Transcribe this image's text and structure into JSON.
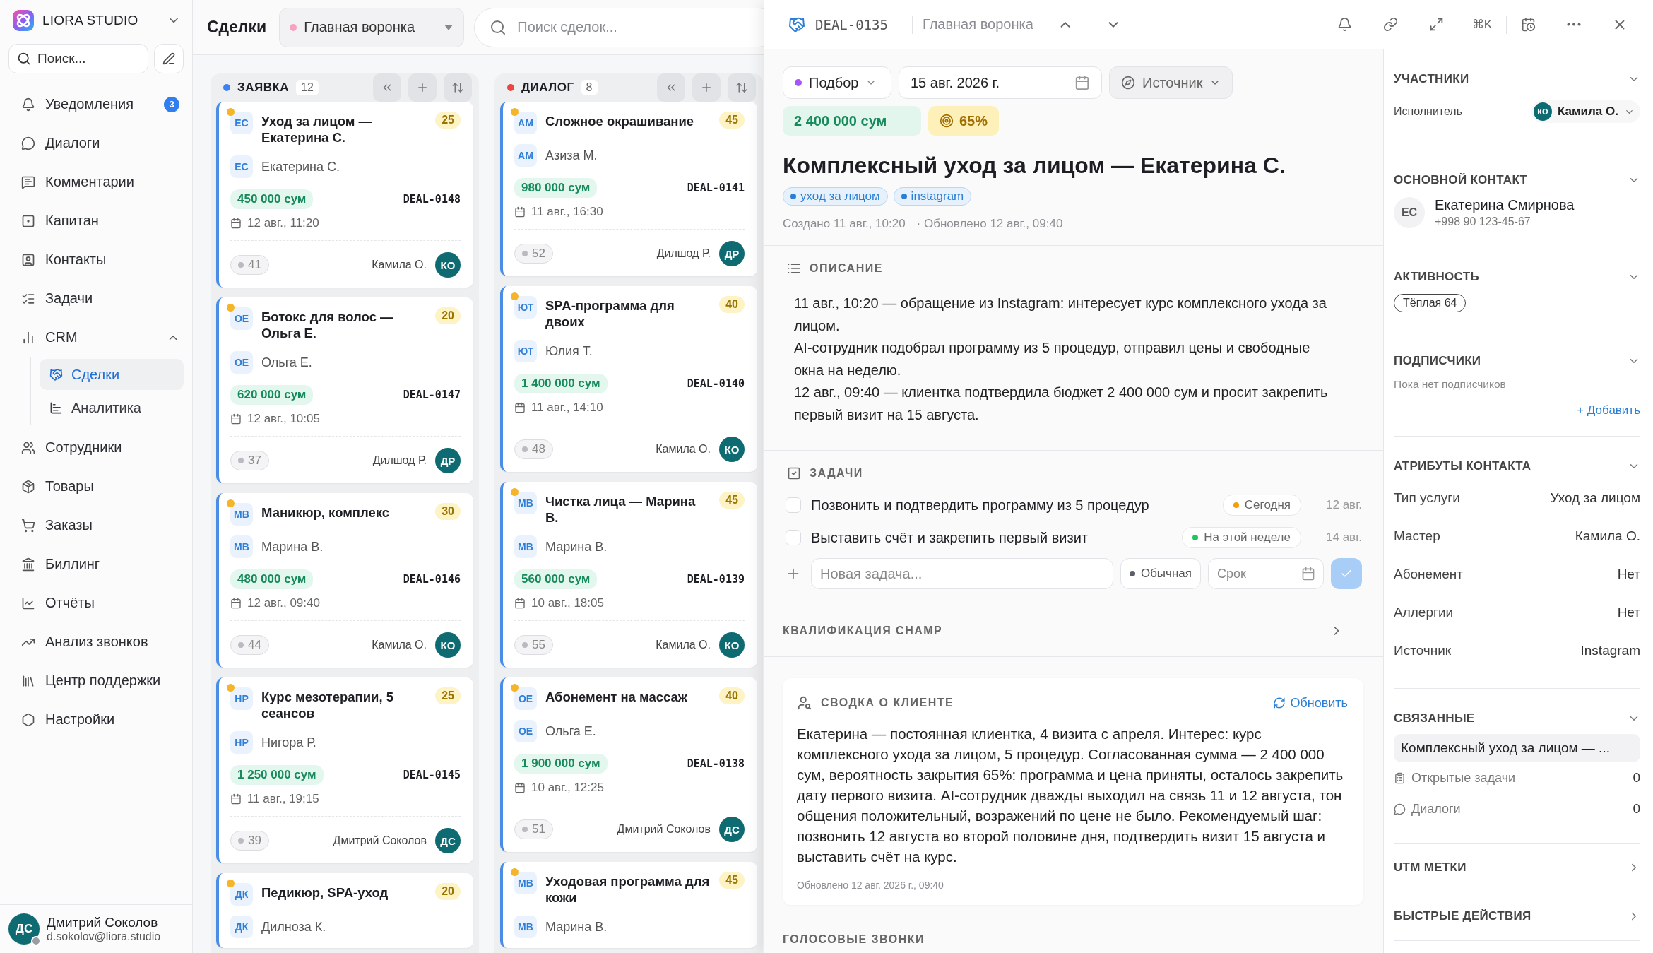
{
  "sidebar": {
    "brand": "LIORA STUDIO",
    "search": {
      "placeholder": "Поиск..."
    },
    "items": [
      {
        "label": "Уведомления",
        "badge": "3",
        "selected": false
      },
      {
        "label": "Диалоги",
        "selected": false
      },
      {
        "label": "Комментарии",
        "selected": false
      },
      {
        "label": "Капитан",
        "selected": false
      },
      {
        "label": "Контакты",
        "selected": false
      },
      {
        "label": "Задачи",
        "selected": false
      },
      {
        "label": "CRM",
        "selected": false,
        "expanded": true,
        "children": [
          {
            "label": "Сделки",
            "selected": true
          },
          {
            "label": "Аналитика",
            "selected": false
          }
        ]
      },
      {
        "label": "Сотрудники",
        "selected": false
      },
      {
        "label": "Товары",
        "selected": false
      },
      {
        "label": "Заказы",
        "selected": false
      },
      {
        "label": "Биллинг",
        "selected": false
      },
      {
        "label": "Отчёты",
        "selected": false
      },
      {
        "label": "Анализ звонков",
        "selected": false
      },
      {
        "label": "Центр поддержки",
        "selected": false
      },
      {
        "label": "Настройки",
        "selected": false
      }
    ],
    "user": {
      "initials": "ДС",
      "name": "Дмитрий Соколов",
      "email": "d.sokolov@liora.studio"
    }
  },
  "board": {
    "title": "Сделки",
    "pipeline": "Главная воронка",
    "search": {
      "placeholder": "Поиск сделок..."
    },
    "columns": [
      {
        "name": "ЗАЯВКА",
        "count": "12",
        "color": "#3b82f6",
        "cards": [
          {
            "initials": "ЕС",
            "title": "Уход за лицом — Екатерина С.",
            "score": "25",
            "contact": "Екатерина С.",
            "contact_initials": "ЕС",
            "amount": "450 000 сум",
            "deal_id": "DEAL-0148",
            "date": "12 авг., 11:20",
            "comments": "41",
            "owner": "Камила О.",
            "owner_initials": "КО"
          },
          {
            "initials": "ОЕ",
            "title": "Ботокс для волос — Ольга Е.",
            "score": "20",
            "contact": "Ольга Е.",
            "contact_initials": "ОЕ",
            "amount": "620 000 сум",
            "deal_id": "DEAL-0147",
            "date": "12 авг., 10:05",
            "comments": "37",
            "owner": "Дилшод Р.",
            "owner_initials": "ДР"
          },
          {
            "initials": "МВ",
            "title": "Маникюр, комплекс",
            "score": "30",
            "contact": "Марина В.",
            "contact_initials": "МВ",
            "amount": "480 000 сум",
            "deal_id": "DEAL-0146",
            "date": "12 авг., 09:40",
            "comments": "44",
            "owner": "Камила О.",
            "owner_initials": "КО"
          },
          {
            "initials": "НР",
            "title": "Курс мезотерапии, 5 сеансов",
            "score": "25",
            "contact": "Нигора Р.",
            "contact_initials": "НР",
            "amount": "1 250 000 сум",
            "deal_id": "DEAL-0145",
            "date": "11 авг., 19:15",
            "comments": "39",
            "owner": "Дмитрий Соколов",
            "owner_initials": "ДС"
          },
          {
            "initials": "ДК",
            "title": "Педикюр, SPA-уход",
            "score": "20",
            "contact": "Дилноза К.",
            "contact_initials": "ДК"
          }
        ]
      },
      {
        "name": "ДИАЛОГ",
        "count": "8",
        "color": "#ef4444",
        "cards": [
          {
            "initials": "АМ",
            "title": "Сложное окрашивание",
            "score": "45",
            "contact": "Азиза М.",
            "contact_initials": "АМ",
            "amount": "980 000 сум",
            "deal_id": "DEAL-0141",
            "date": "11 авг., 16:30",
            "comments": "52",
            "owner": "Дилшод Р.",
            "owner_initials": "ДР"
          },
          {
            "initials": "ЮТ",
            "title": "SPA-программа для двоих",
            "score": "40",
            "contact": "Юлия Т.",
            "contact_initials": "ЮТ",
            "amount": "1 400 000 сум",
            "deal_id": "DEAL-0140",
            "date": "11 авг., 14:10",
            "comments": "48",
            "owner": "Камила О.",
            "owner_initials": "КО"
          },
          {
            "initials": "МВ",
            "title": "Чистка лица — Марина В.",
            "score": "45",
            "contact": "Марина В.",
            "contact_initials": "МВ",
            "amount": "560 000 сум",
            "deal_id": "DEAL-0139",
            "date": "10 авг., 18:05",
            "comments": "55",
            "owner": "Камила О.",
            "owner_initials": "КО"
          },
          {
            "initials": "ОЕ",
            "title": "Абонемент на массаж",
            "score": "40",
            "contact": "Ольга Е.",
            "contact_initials": "ОЕ",
            "amount": "1 900 000 сум",
            "deal_id": "DEAL-0138",
            "date": "10 авг., 12:25",
            "comments": "51",
            "owner": "Дмитрий Соколов",
            "owner_initials": "ДС"
          },
          {
            "initials": "МВ",
            "title": "Уходовая программа для кожи",
            "score": "45",
            "contact": "Марина В.",
            "contact_initials": "МВ"
          }
        ]
      }
    ]
  },
  "detail": {
    "deal_id": "DEAL-0135",
    "pipeline": "Главная воронка",
    "shortcut": "⌘K",
    "stage": {
      "label": "Подбор",
      "color": "#a855f7"
    },
    "date": "15 авг. 2026 г.",
    "source": "Источник",
    "amount": "2 400 000 сум",
    "probability": "65%",
    "title": "Комплексный уход за лицом — Екатерина С.",
    "tags": [
      "уход за лицом",
      "instagram"
    ],
    "created": "Создано 11 авг., 10:20",
    "updated": "· Обновлено 12 авг., 09:40",
    "description": {
      "title": "ОПИСАНИЕ",
      "lines": [
        "11 авг., 10:20 — обращение из Instagram: интересует курс комплексного ухода за лицом.",
        "AI-сотрудник подобрал программу из 5 процедур, отправил цены и свободные окна на неделю.",
        "12 авг., 09:40 — клиентка подтвердила бюджет 2 400 000 сум и просит закрепить первый визит на 15 августа."
      ]
    },
    "tasks": {
      "title": "ЗАДАЧИ",
      "items": [
        {
          "text": "Позвонить и подтвердить программу из 5 процедур",
          "checked": false,
          "due": "Сегодня",
          "color": "#f59e0b",
          "date": "12 авг."
        },
        {
          "text": "Выставить счёт и закрепить первый визит",
          "checked": false,
          "due": "На этой неделе",
          "color": "#22c55e",
          "date": "14 авг."
        }
      ],
      "new_task": {
        "placeholder": "Новая задача...",
        "priority": "Обычная",
        "deadline_placeholder": "Срок"
      }
    },
    "qualification": {
      "title": "КВАЛИФИКАЦИЯ CHAMP",
      "expanded": false
    },
    "summary": {
      "title": "СВОДКА О КЛИЕНТЕ",
      "refresh": "Обновить",
      "text": "Екатерина — постоянная клиентка, 4 визита с апреля. Интерес: курс комплексного ухода за лицом, 5 процедур. Согласованная сумма — 2 400 000 сум, вероятность закрытия 65%: программа и цена приняты, осталось закрепить дату первого визита. AI-сотрудник дважды выходил на связь 11 и 12 августа, тон общения положительный, возражений по цене не было. Рекомендуемый шаг: позвонить 12 августа во второй половине дня, подтвердить визит 15 августа и выставить счёт на курс.",
      "updated": "Обновлено 12 авг. 2026 г., 09:40"
    },
    "voice_calls": {
      "title": "ГОЛОСОВЫЕ ЗВОНКИ"
    }
  },
  "panel": {
    "sections": [
      {
        "kind": "assignee",
        "title": "УЧАСТНИКИ",
        "expanded": true,
        "label": "Исполнитель",
        "initials": "КО",
        "name": "Камила О."
      },
      {
        "kind": "contact",
        "title": "ОСНОВНОЙ КОНТАКТ",
        "expanded": true,
        "initials": "ЕС",
        "name": "Екатерина Смирнова",
        "phone": "+998 90 123-45-67"
      },
      {
        "kind": "activity",
        "title": "АКТИВНОСТЬ",
        "expanded": true,
        "badge": "Тёплая 64"
      },
      {
        "kind": "subscribers",
        "title": "ПОДПИСЧИКИ",
        "expanded": true,
        "hint": "Пока нет подписчиков",
        "action": "+ Добавить"
      },
      {
        "kind": "attributes",
        "title": "АТРИБУТЫ КОНТАКТА",
        "expanded": true,
        "rows": [
          {
            "label": "Тип услуги",
            "value": "Уход за лицом"
          },
          {
            "label": "Мастер",
            "value": "Камила О."
          },
          {
            "label": "Абонемент",
            "value": "Нет"
          },
          {
            "label": "Аллергии",
            "value": "Нет"
          },
          {
            "label": "Источник",
            "value": "Instagram"
          }
        ]
      },
      {
        "kind": "related",
        "title": "СВЯЗАННЫЕ",
        "expanded": true,
        "link": "Комплексный уход за лицом — ...",
        "rows": [
          {
            "label": "Открытые задачи",
            "value": "0"
          },
          {
            "label": "Диалоги",
            "value": "0"
          }
        ]
      },
      {
        "title": "UTM МЕТКИ",
        "expanded": false
      },
      {
        "title": "БЫСТРЫЕ ДЕЙСТВИЯ",
        "expanded": false
      }
    ]
  }
}
